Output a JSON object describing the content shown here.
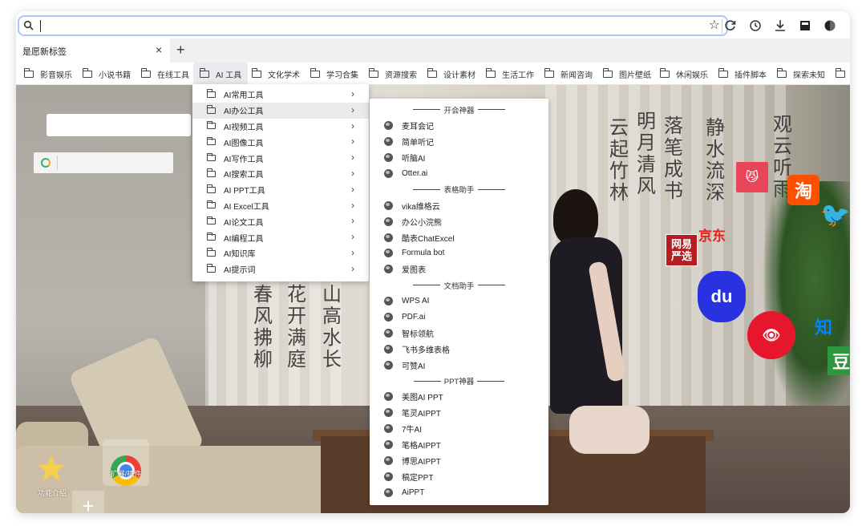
{
  "browser": {
    "tab_title": "是愿新标签",
    "tab_close": "×",
    "new_tab": "+",
    "star": "☆",
    "toolbar_icons": [
      "reload-icon",
      "history-icon",
      "download-icon",
      "extension-icon",
      "profile-icon"
    ]
  },
  "bookmarks": [
    {
      "label": "影音娱乐"
    },
    {
      "label": "小说书籍"
    },
    {
      "label": "在线工具"
    },
    {
      "label": "AI 工具"
    },
    {
      "label": "文化学术"
    },
    {
      "label": "学习合集"
    },
    {
      "label": "资源搜索"
    },
    {
      "label": "设计素材"
    },
    {
      "label": "生活工作"
    },
    {
      "label": "新闻咨询"
    },
    {
      "label": "图片壁纸"
    },
    {
      "label": "休闲娱乐"
    },
    {
      "label": "插件脚本"
    },
    {
      "label": "探索未知"
    }
  ],
  "ai_menu": {
    "items": [
      {
        "label": "AI常用工具"
      },
      {
        "label": "AI办公工具"
      },
      {
        "label": "AI视频工具"
      },
      {
        "label": "AI图像工具"
      },
      {
        "label": "AI写作工具"
      },
      {
        "label": "AI搜索工具"
      },
      {
        "label": "AI PPT工具"
      },
      {
        "label": "AI Excel工具"
      },
      {
        "label": "AI论文工具"
      },
      {
        "label": "AI编程工具"
      },
      {
        "label": "AI知识库"
      },
      {
        "label": "AI提示词"
      }
    ],
    "arrow": "›"
  },
  "office_menu": {
    "rows": [
      {
        "type": "header",
        "label": "开会神器"
      },
      {
        "type": "item",
        "label": "麦耳会记"
      },
      {
        "type": "item",
        "label": "简单听记"
      },
      {
        "type": "item",
        "label": "听脑AI"
      },
      {
        "type": "item",
        "label": "Otter.ai"
      },
      {
        "type": "header",
        "label": "表格助手"
      },
      {
        "type": "item",
        "label": "vika维格云"
      },
      {
        "type": "item",
        "label": "办公小浣熊"
      },
      {
        "type": "item",
        "label": "酷表ChatExcel"
      },
      {
        "type": "item",
        "label": "Formula bot"
      },
      {
        "type": "item",
        "label": "爱图表"
      },
      {
        "type": "header",
        "label": "文档助手"
      },
      {
        "type": "item",
        "label": "WPS AI"
      },
      {
        "type": "item",
        "label": "PDF.ai"
      },
      {
        "type": "item",
        "label": "智标领航"
      },
      {
        "type": "item",
        "label": "飞书多维表格"
      },
      {
        "type": "item",
        "label": "可赞AI"
      },
      {
        "type": "header",
        "label": "PPT神器"
      },
      {
        "type": "item",
        "label": "美图AI PPT"
      },
      {
        "type": "item",
        "label": "笔灵AIPPT"
      },
      {
        "type": "item",
        "label": "7牛AI"
      },
      {
        "type": "item",
        "label": "笔格AIPPT"
      },
      {
        "type": "item",
        "label": "博思AIPPT"
      },
      {
        "type": "item",
        "label": "稿定PPT"
      },
      {
        "type": "item",
        "label": "AiPPT"
      }
    ]
  },
  "desktop": {
    "star_tile_label": "功能介绍",
    "chrome_tile_label": "扩展/插件",
    "add_tile": "+",
    "sites": {
      "tmall": "天猫",
      "taobao": "淘",
      "jd": "京东",
      "wangyi": "网易严选",
      "baidu": "du",
      "weibo": "微博",
      "zhihu": "知",
      "douban": "豆"
    }
  },
  "wallpaper_text": {
    "columns": [
      "春风拂柳",
      "花开满庭",
      "山高水长",
      "云起竹林",
      "明月清风",
      "落笔成书",
      "静水流深",
      "观云听雨"
    ]
  }
}
